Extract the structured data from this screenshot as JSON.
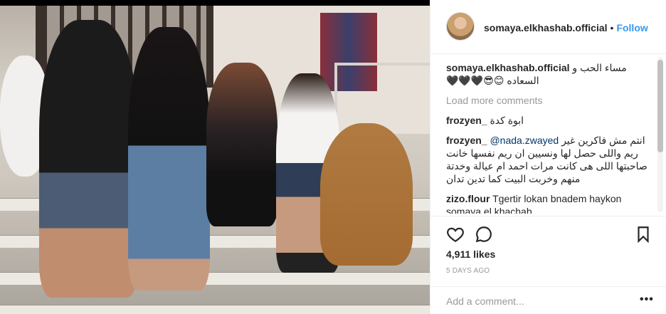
{
  "post": {
    "image_icon": "family-photo",
    "header": {
      "username": "somaya.elkhashab.official",
      "separator": "•",
      "follow_label": "Follow"
    },
    "caption": {
      "username": "somaya.elkhashab.official",
      "text": "مساء الحب و السعاده 😊😎🖤🖤🖤"
    },
    "load_more_label": "Load more comments",
    "comments": [
      {
        "username": "frozyen_",
        "text": "ابوة كدة"
      },
      {
        "username": "frozyen_",
        "mention": "@nada.zwayed",
        "text": "انتم مش فاكرين غير ريم واللى حصل لها ونسيين ان ريم نفسها خانت صاحبتها اللى هى كانت مرات احمد ام عيالة وخدتة منهم وخربت البيت كما تدين تدان"
      },
      {
        "username": "zizo.flour",
        "text": "Tgertir lokan bnadem haykon somaya el khachab"
      }
    ],
    "actions": {
      "like_icon": "heart-icon",
      "comment_icon": "comment-bubble-icon",
      "save_icon": "bookmark-icon"
    },
    "likes": "4,911 likes",
    "time_ago": "5 days ago",
    "add_comment_placeholder": "Add a comment...",
    "more_label": "•••",
    "colors": {
      "link": "#3897f0",
      "muted": "#999999",
      "text": "#262626",
      "border": "#efefef"
    }
  }
}
